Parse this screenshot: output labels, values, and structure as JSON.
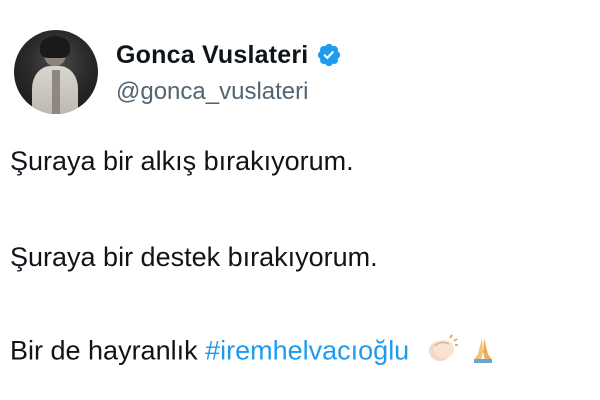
{
  "tweet": {
    "author": {
      "display_name": "Gonca Vuslateri",
      "handle": "@gonca_vuslateri",
      "verified_color": "#1d9bf0"
    },
    "lines": {
      "line1": "Şuraya bir alkış bırakıyorum.",
      "line2": "Şuraya bir destek bırakıyorum.",
      "line3_prefix": "Bir de hayranlık ",
      "line3_hashtag": "#iremhelvacıoğlu",
      "line3_emojis": [
        "clapping-hands-icon",
        "folded-hands-icon"
      ]
    },
    "colors": {
      "text": "#0f1419",
      "secondary": "#536471",
      "link": "#1d9bf0"
    }
  }
}
